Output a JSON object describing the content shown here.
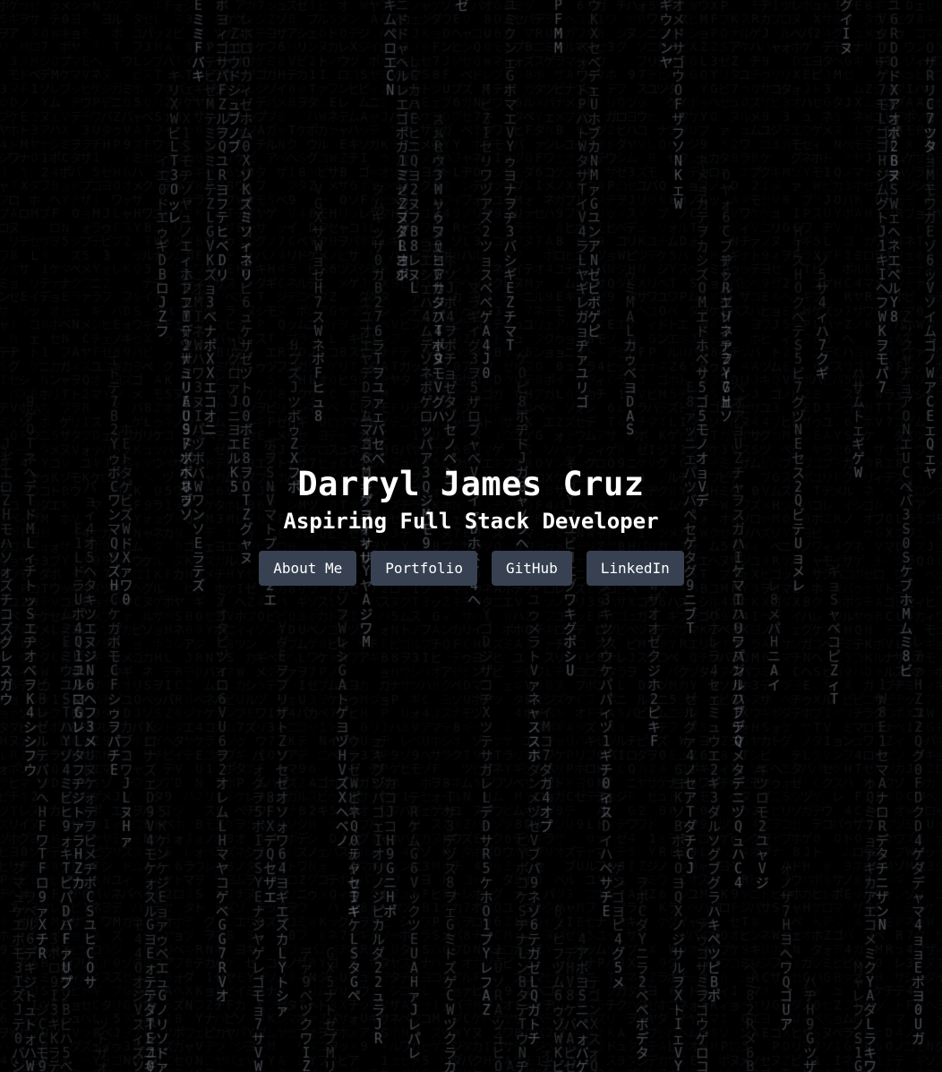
{
  "hero": {
    "name": "Darryl James Cruz",
    "tagline": "Aspiring Full Stack Developer"
  },
  "nav": {
    "about": "About Me",
    "portfolio": "Portfolio",
    "github": "GitHub",
    "linkedin": "LinkedIn"
  },
  "colors": {
    "background": "#000000",
    "button": "#374151",
    "button_text": "#ffffff",
    "rain_bright": "#b4bccb",
    "rain_dim": "#1b1f27"
  },
  "rain_charset": "アイウエオカキクケコサシスセソタチツテトナニヌネノハヒフヘホマミムメモヤユヨラリルレロワヲンガギグゲゴザジズゼゾダヂヅデドバビブベボパピプペポァィゥェォャュョッ0123456789ABCDEFGHIJKLMNOPQRSTUVWXYZ"
}
